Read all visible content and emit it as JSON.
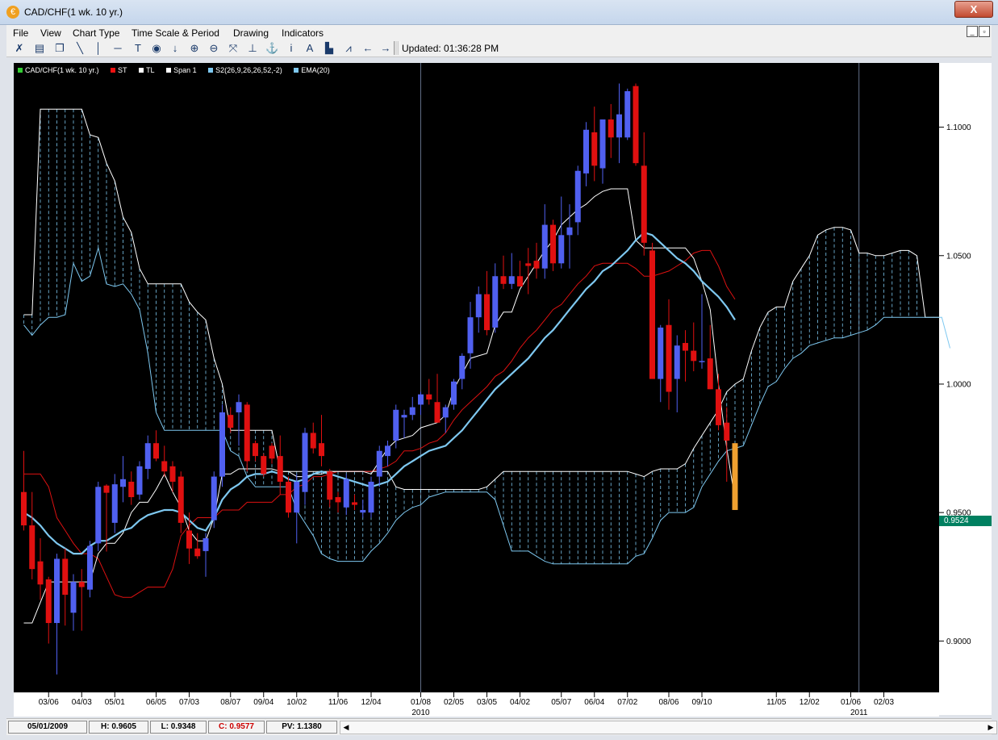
{
  "window": {
    "title": "CAD/CHF(1 wk.  10 yr.)",
    "close_label": "X",
    "icon_glyph": "€"
  },
  "menu": {
    "items": [
      "File",
      "View",
      "Chart Type",
      "Time Scale & Period",
      "Drawing",
      "Indicators"
    ]
  },
  "toolbar": {
    "updated_text": "Updated: 01:36:28 PM",
    "icons": [
      "x-chart-icon",
      "print-icon",
      "copy-icon",
      "trendline-icon",
      "vertical-line-icon",
      "horizontal-line-icon",
      "text-icon",
      "circle-icon",
      "down-arrow-icon",
      "zoom-in-icon",
      "zoom-out-icon",
      "fit-icon",
      "baseline-icon",
      "anchor-icon",
      "info-icon",
      "font-icon",
      "bar-chart-icon",
      "line-icon",
      "left-arrow-icon",
      "right-arrow-icon"
    ]
  },
  "legend": [
    {
      "label": "CAD/CHF(1 wk.  10 yr.)",
      "color": "#33cc33"
    },
    {
      "label": "ST",
      "color": "#ee1111"
    },
    {
      "label": "TL",
      "color": "#ffffff"
    },
    {
      "label": "Span 1",
      "color": "#ffffff"
    },
    {
      "label": "S2(26,9,26,26,52,-2)",
      "color": "#7ec8f0"
    },
    {
      "label": "EMA(20)",
      "color": "#7ec8f0"
    }
  ],
  "price_tag": "0.9524",
  "status": {
    "date": "05/01/2009",
    "high": "H: 0.9605",
    "low": "L: 0.9348",
    "close": "C: 0.9577",
    "pv": "PV: 1.1380"
  },
  "chart_data": {
    "type": "candlestick",
    "title": "",
    "y_ticks": [
      "1.1000",
      "1.0500",
      "1.0000",
      "0.9500",
      "0.9000"
    ],
    "ylim": [
      0.88,
      1.125
    ],
    "x_ticks": [
      "03/06",
      "04/03",
      "05/01",
      "06/05",
      "07/03",
      "08/07",
      "09/04",
      "10/02",
      "11/06",
      "12/04",
      "01/08",
      "02/05",
      "03/05",
      "04/02",
      "05/07",
      "06/04",
      "07/02",
      "08/06",
      "09/10",
      "11/05",
      "12/02",
      "01/06",
      "02/03"
    ],
    "x_years": [
      "2010",
      "2011"
    ],
    "colors": {
      "up": "#5060f0",
      "down": "#e01010",
      "last": "#f0a030",
      "cloud": "#7ec8f0",
      "ema": "#7ec8f0",
      "tl": "#ffffff",
      "st": "#dd1111"
    },
    "candles": [
      [
        0.958,
        0.974,
        0.943,
        0.945
      ],
      [
        0.945,
        0.958,
        0.924,
        0.928
      ],
      [
        0.931,
        0.94,
        0.916,
        0.922
      ],
      [
        0.924,
        0.925,
        0.899,
        0.907
      ],
      [
        0.907,
        0.934,
        0.887,
        0.932
      ],
      [
        0.932,
        0.936,
        0.906,
        0.918
      ],
      [
        0.911,
        0.926,
        0.904,
        0.923
      ],
      [
        0.923,
        0.928,
        0.904,
        0.921
      ],
      [
        0.92,
        0.939,
        0.917,
        0.937
      ],
      [
        0.938,
        0.962,
        0.935,
        0.96
      ],
      [
        0.9605,
        0.961,
        0.9348,
        0.9577
      ],
      [
        0.946,
        0.965,
        0.942,
        0.961
      ],
      [
        0.96,
        0.972,
        0.954,
        0.963
      ],
      [
        0.962,
        0.966,
        0.953,
        0.956
      ],
      [
        0.957,
        0.97,
        0.955,
        0.968
      ],
      [
        0.967,
        0.98,
        0.963,
        0.977
      ],
      [
        0.977,
        0.982,
        0.97,
        0.971
      ],
      [
        0.97,
        0.976,
        0.964,
        0.966
      ],
      [
        0.968,
        0.97,
        0.958,
        0.962
      ],
      [
        0.964,
        0.966,
        0.942,
        0.946
      ],
      [
        0.943,
        0.95,
        0.93,
        0.936
      ],
      [
        0.936,
        0.942,
        0.932,
        0.933
      ],
      [
        0.935,
        0.942,
        0.925,
        0.94
      ],
      [
        0.947,
        0.966,
        0.944,
        0.964
      ],
      [
        0.964,
        0.992,
        0.96,
        0.989
      ],
      [
        0.988,
        0.991,
        0.981,
        0.983
      ],
      [
        0.989,
        0.996,
        0.976,
        0.993
      ],
      [
        0.992,
        0.993,
        0.966,
        0.97
      ],
      [
        0.977,
        0.978,
        0.97,
        0.972
      ],
      [
        0.972,
        0.973,
        0.964,
        0.965
      ],
      [
        0.976,
        0.977,
        0.969,
        0.971
      ],
      [
        0.972,
        0.98,
        0.957,
        0.962
      ],
      [
        0.962,
        0.964,
        0.948,
        0.95
      ],
      [
        0.95,
        0.965,
        0.938,
        0.962
      ],
      [
        0.958,
        0.983,
        0.953,
        0.981
      ],
      [
        0.981,
        0.985,
        0.973,
        0.975
      ],
      [
        0.977,
        0.988,
        0.968,
        0.972
      ],
      [
        0.966,
        0.967,
        0.952,
        0.955
      ],
      [
        0.956,
        0.958,
        0.95,
        0.954
      ],
      [
        0.952,
        0.965,
        0.949,
        0.963
      ],
      [
        0.954,
        0.957,
        0.951,
        0.953
      ],
      [
        0.95,
        0.955,
        0.948,
        0.951
      ],
      [
        0.95,
        0.964,
        0.948,
        0.962
      ],
      [
        0.964,
        0.976,
        0.96,
        0.974
      ],
      [
        0.972,
        0.978,
        0.968,
        0.976
      ],
      [
        0.978,
        0.992,
        0.975,
        0.99
      ],
      [
        0.987,
        0.99,
        0.979,
        0.988
      ],
      [
        0.988,
        0.995,
        0.986,
        0.991
      ],
      [
        0.992,
        0.997,
        0.988,
        0.996
      ],
      [
        0.996,
        1.002,
        0.992,
        0.994
      ],
      [
        0.993,
        1.004,
        0.985,
        0.985
      ],
      [
        0.987,
        0.992,
        0.981,
        0.991
      ],
      [
        0.992,
        1.002,
        0.99,
        1.001
      ],
      [
        1.002,
        1.012,
        0.998,
        1.011
      ],
      [
        1.012,
        1.032,
        1.006,
        1.026
      ],
      [
        1.026,
        1.038,
        1.02,
        1.035
      ],
      [
        1.035,
        1.044,
        1.019,
        1.021
      ],
      [
        1.022,
        1.047,
        1.02,
        1.042
      ],
      [
        1.042,
        1.05,
        1.037,
        1.039
      ],
      [
        1.039,
        1.051,
        1.037,
        1.042
      ],
      [
        1.042,
        1.048,
        1.038,
        1.038
      ],
      [
        1.047,
        1.053,
        1.035,
        1.046
      ],
      [
        1.048,
        1.055,
        1.041,
        1.045
      ],
      [
        1.045,
        1.07,
        1.041,
        1.062
      ],
      [
        1.062,
        1.064,
        1.044,
        1.047
      ],
      [
        1.047,
        1.073,
        1.045,
        1.058
      ],
      [
        1.058,
        1.07,
        1.045,
        1.061
      ],
      [
        1.063,
        1.085,
        1.058,
        1.083
      ],
      [
        1.082,
        1.102,
        1.077,
        1.099
      ],
      [
        1.098,
        1.108,
        1.079,
        1.085
      ],
      [
        1.084,
        1.102,
        1.078,
        1.103
      ],
      [
        1.103,
        1.109,
        1.088,
        1.096
      ],
      [
        1.096,
        1.117,
        1.086,
        1.105
      ],
      [
        1.096,
        1.115,
        1.095,
        1.114
      ],
      [
        1.116,
        1.117,
        1.085,
        1.086
      ],
      [
        1.085,
        1.098,
        1.05,
        1.055
      ],
      [
        1.052,
        1.055,
        1.01,
        1.002
      ],
      [
        1.002,
        1.023,
        0.993,
        1.022
      ],
      [
        1.023,
        1.033,
        0.99,
        0.997
      ],
      [
        1.002,
        1.019,
        0.989,
        1.015
      ],
      [
        1.016,
        1.021,
        1.001,
        1.013
      ],
      [
        1.013,
        1.024,
        1.005,
        1.009
      ],
      [
        1.009,
        1.035,
        1.006,
        1.009
      ],
      [
        1.01,
        1.023,
        0.998,
        0.998
      ],
      [
        0.998,
        1.004,
        0.982,
        0.984
      ],
      [
        0.985,
        0.991,
        0.962,
        0.978
      ],
      [
        0.977,
        0.977,
        0.951,
        0.951
      ]
    ],
    "ema_values": [
      0.95,
      0.948,
      0.945,
      0.941,
      0.938,
      0.936,
      0.934,
      0.934,
      0.937,
      0.939,
      0.939,
      0.941,
      0.943,
      0.944,
      0.947,
      0.949,
      0.95,
      0.951,
      0.951,
      0.95,
      0.947,
      0.944,
      0.943,
      0.948,
      0.955,
      0.959,
      0.961,
      0.964,
      0.965,
      0.965,
      0.966,
      0.965,
      0.963,
      0.962,
      0.963,
      0.965,
      0.966,
      0.965,
      0.964,
      0.963,
      0.962,
      0.961,
      0.96,
      0.961,
      0.962,
      0.965,
      0.968,
      0.97,
      0.972,
      0.974,
      0.975,
      0.976,
      0.979,
      0.982,
      0.986,
      0.99,
      0.994,
      0.998,
      1.001,
      1.004,
      1.007,
      1.01,
      1.014,
      1.018,
      1.021,
      1.025,
      1.029,
      1.033,
      1.037,
      1.04,
      1.044,
      1.046,
      1.049,
      1.052,
      1.056,
      1.059,
      1.058,
      1.055,
      1.052,
      1.049,
      1.047,
      1.044,
      1.04,
      1.037,
      1.034,
      1.03,
      1.025
    ],
    "tl_values": [
      0.907,
      0.907,
      0.915,
      0.923,
      0.923,
      0.923,
      0.923,
      0.923,
      0.923,
      0.934,
      0.938,
      0.938,
      0.942,
      0.95,
      0.954,
      0.954,
      0.959,
      0.965,
      0.958,
      0.952,
      0.943,
      0.939,
      0.939,
      0.948,
      0.965,
      0.965,
      0.967,
      0.967,
      0.967,
      0.967,
      0.967,
      0.966,
      0.966,
      0.964,
      0.964,
      0.965,
      0.965,
      0.966,
      0.966,
      0.966,
      0.966,
      0.966,
      0.965,
      0.97,
      0.975,
      0.978,
      0.979,
      0.98,
      0.983,
      0.984,
      0.985,
      0.988,
      0.998,
      1.004,
      1.01,
      1.011,
      1.012,
      1.023,
      1.028,
      1.028,
      1.037,
      1.042,
      1.047,
      1.052,
      1.056,
      1.062,
      1.065,
      1.068,
      1.07,
      1.073,
      1.075,
      1.076,
      1.076,
      1.076,
      1.056,
      1.053,
      1.053,
      1.053,
      1.053,
      1.053,
      1.053,
      1.049,
      1.04,
      1.029,
      1.0,
      0.975,
      0.955
    ],
    "st_values": [
      0.965,
      0.965,
      0.965,
      0.96,
      0.948,
      0.943,
      0.938,
      0.934,
      0.934,
      0.932,
      0.925,
      0.918,
      0.917,
      0.917,
      0.919,
      0.921,
      0.921,
      0.921,
      0.928,
      0.941,
      0.945,
      0.948,
      0.948,
      0.948,
      0.951,
      0.951,
      0.951,
      0.954,
      0.954,
      0.954,
      0.954,
      0.957,
      0.957,
      0.96,
      0.961,
      0.964,
      0.964,
      0.965,
      0.966,
      0.966,
      0.966,
      0.966,
      0.966,
      0.967,
      0.968,
      0.97,
      0.974,
      0.974,
      0.975,
      0.977,
      0.978,
      0.981,
      0.986,
      0.99,
      0.993,
      0.996,
      0.999,
      1.003,
      1.005,
      1.009,
      1.014,
      1.018,
      1.021,
      1.025,
      1.029,
      1.031,
      1.035,
      1.039,
      1.042,
      1.046,
      1.047,
      1.047,
      1.047,
      1.047,
      1.045,
      1.042,
      1.042,
      1.043,
      1.044,
      1.046,
      1.048,
      1.051,
      1.052,
      1.052,
      1.046,
      1.038,
      1.033
    ],
    "cloud_top": [
      1.027,
      1.027,
      1.107,
      1.107,
      1.107,
      1.107,
      1.107,
      1.107,
      1.097,
      1.096,
      1.086,
      1.079,
      1.065,
      1.059,
      1.045,
      1.039,
      1.039,
      1.039,
      1.039,
      1.039,
      1.032,
      1.028,
      1.025,
      1.01,
      1.0,
      0.982,
      0.982,
      0.982,
      0.982,
      0.982,
      0.982,
      0.966,
      0.966,
      0.966,
      0.966,
      0.966,
      0.966,
      0.966,
      0.966,
      0.966,
      0.966,
      0.966,
      0.966,
      0.966,
      0.966,
      0.96,
      0.959,
      0.959,
      0.959,
      0.959,
      0.959,
      0.959,
      0.959,
      0.959,
      0.959,
      0.959,
      0.96,
      0.963,
      0.966,
      0.966,
      0.966,
      0.966,
      0.966,
      0.966,
      0.966,
      0.966,
      0.966,
      0.966,
      0.966,
      0.966,
      0.966,
      0.966,
      0.966,
      0.966,
      0.965,
      0.964,
      0.966,
      0.967,
      0.967,
      0.967,
      0.969,
      0.975,
      0.98,
      0.985,
      0.99,
      0.997,
      1.0,
      1.002,
      1.013,
      1.022,
      1.028,
      1.03,
      1.03,
      1.04,
      1.045,
      1.05,
      1.058,
      1.06,
      1.061,
      1.061,
      1.06,
      1.051,
      1.051,
      1.05,
      1.05,
      1.051,
      1.052,
      1.052,
      1.05,
      1.026,
      1.026,
      1.026,
      1.014
    ],
    "cloud_bottom": [
      1.023,
      1.019,
      1.023,
      1.026,
      1.026,
      1.027,
      1.047,
      1.04,
      1.042,
      1.053,
      1.039,
      1.038,
      1.039,
      1.035,
      1.029,
      1.012,
      0.989,
      0.982,
      0.982,
      0.982,
      0.982,
      0.982,
      0.982,
      0.982,
      0.982,
      0.974,
      0.972,
      0.964,
      0.96,
      0.96,
      0.96,
      0.96,
      0.96,
      0.951,
      0.946,
      0.941,
      0.934,
      0.932,
      0.931,
      0.931,
      0.931,
      0.931,
      0.935,
      0.938,
      0.942,
      0.947,
      0.95,
      0.952,
      0.953,
      0.956,
      0.957,
      0.958,
      0.958,
      0.958,
      0.958,
      0.958,
      0.958,
      0.955,
      0.945,
      0.935,
      0.935,
      0.935,
      0.933,
      0.931,
      0.93,
      0.93,
      0.93,
      0.93,
      0.93,
      0.93,
      0.93,
      0.93,
      0.93,
      0.93,
      0.933,
      0.934,
      0.94,
      0.947,
      0.95,
      0.95,
      0.95,
      0.952,
      0.96,
      0.965,
      0.97,
      0.974,
      0.975,
      0.976,
      0.984,
      0.992,
      0.999,
      1.001,
      1.006,
      1.01,
      1.012,
      1.015,
      1.016,
      1.017,
      1.018,
      1.018,
      1.019,
      1.02,
      1.021,
      1.023,
      1.026,
      1.026,
      1.026,
      1.026,
      1.026,
      1.026,
      1.026,
      1.026,
      1.014
    ]
  }
}
